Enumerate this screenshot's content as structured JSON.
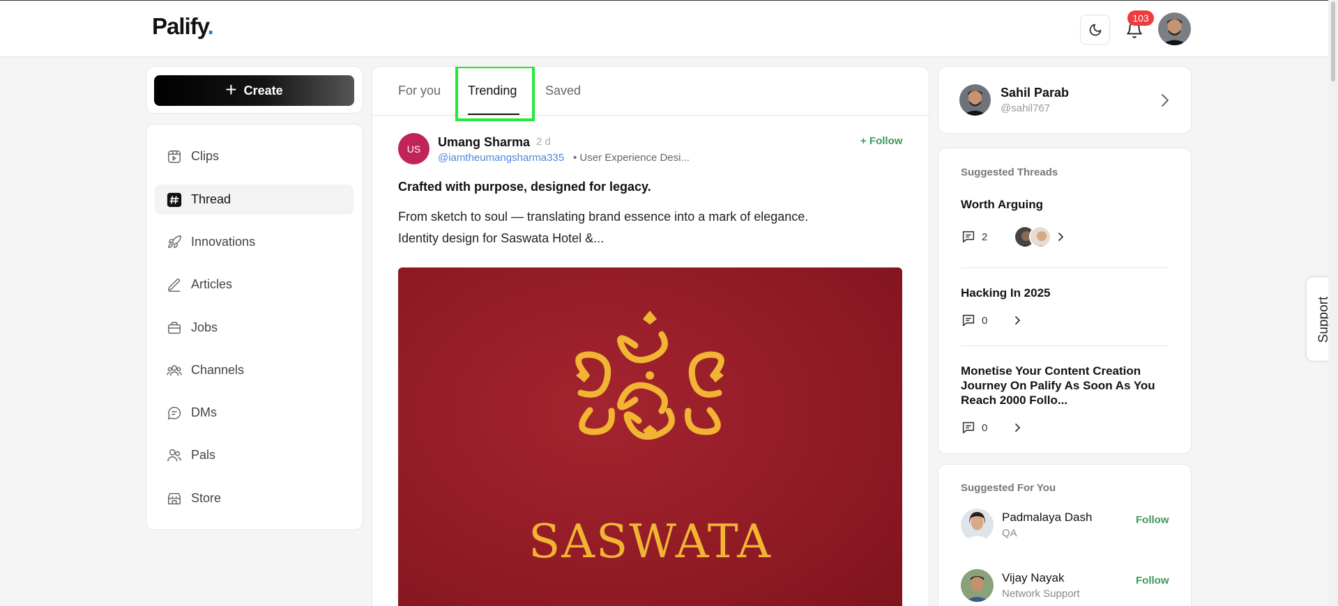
{
  "app": {
    "logo": "Palify",
    "logo_dot": "."
  },
  "header": {
    "notifications_count": "103"
  },
  "sidebar": {
    "create_label": "Create",
    "items": [
      {
        "label": "Clips",
        "icon": "clips-icon"
      },
      {
        "label": "Thread",
        "icon": "hash-icon",
        "active": true
      },
      {
        "label": "Innovations",
        "icon": "rocket-icon"
      },
      {
        "label": "Articles",
        "icon": "pen-icon"
      },
      {
        "label": "Jobs",
        "icon": "briefcase-icon"
      },
      {
        "label": "Channels",
        "icon": "users-icon"
      },
      {
        "label": "DMs",
        "icon": "message-icon"
      },
      {
        "label": "Pals",
        "icon": "pals-icon"
      },
      {
        "label": "Store",
        "icon": "store-icon"
      }
    ]
  },
  "feed": {
    "tabs": [
      {
        "label": "For you"
      },
      {
        "label": "Trending",
        "active": true
      },
      {
        "label": "Saved"
      }
    ],
    "post": {
      "avatar_initials": "US",
      "author": "Umang Sharma",
      "time": "2 d",
      "handle": "@iamtheumangsharma335",
      "role": "• User Experience Desi...",
      "follow_label": "+ Follow",
      "title": "Crafted with purpose, designed for legacy.",
      "body_line1": "From sketch to soul — translating brand essence into a mark of elegance.",
      "body_line2": "Identity design for Saswata Hotel &...",
      "image_text": "SASWATA"
    }
  },
  "profile": {
    "name": "Sahil Parab",
    "handle": "@sahil767"
  },
  "suggested_threads": {
    "label": "Suggested Threads",
    "items": [
      {
        "title": "Worth Arguing",
        "comments": "2"
      },
      {
        "title": "Hacking In 2025",
        "comments": "0"
      },
      {
        "title": "Monetise Your Content Creation Journey On Palify As Soon As You Reach 2000 Follo...",
        "comments": "0"
      }
    ]
  },
  "suggested_for_you": {
    "label": "Suggested For You",
    "items": [
      {
        "name": "Padmalaya Dash",
        "role": "QA",
        "follow_label": "Follow"
      },
      {
        "name": "Vijay Nayak",
        "role": "Network Support",
        "follow_label": "Follow"
      }
    ]
  },
  "support": {
    "label": "Support"
  },
  "colors": {
    "accent_green": "#3a9a5a",
    "badge_red": "#ef3b3b",
    "link_blue": "#4a89dc",
    "highlight_green": "#22e83a"
  }
}
